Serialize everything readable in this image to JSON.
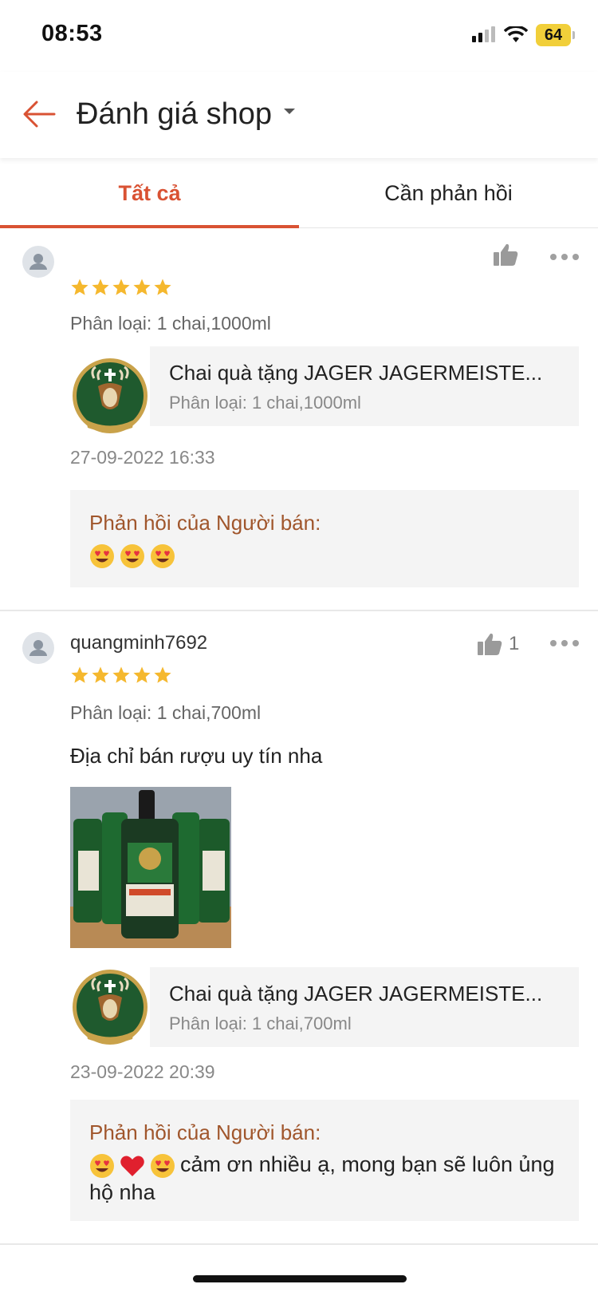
{
  "status_bar": {
    "time": "08:53",
    "battery": "64"
  },
  "header": {
    "title": "Đánh giá shop"
  },
  "tabs": [
    {
      "label": "Tất cả",
      "active": true
    },
    {
      "label": "Cần phản hồi",
      "active": false
    }
  ],
  "reviews": [
    {
      "username": "",
      "likes": "",
      "rating": 5,
      "variant": "Phân loại: 1 chai,1000ml",
      "comment": "",
      "product": {
        "name": "Chai quà tặng JAGER JAGERMEISTE...",
        "variant": "Phân loại: 1 chai,1000ml"
      },
      "timestamp": "27-09-2022 16:33",
      "reply_label": "Phản hồi của Người bán:",
      "reply_text": ""
    },
    {
      "username": "quangminh7692",
      "likes": "1",
      "rating": 5,
      "variant": "Phân loại: 1 chai,700ml",
      "comment": "Địa chỉ bán rượu uy tín nha",
      "product": {
        "name": "Chai quà tặng JAGER JAGERMEISTE...",
        "variant": "Phân loại: 1 chai,700ml"
      },
      "timestamp": "23-09-2022 20:39",
      "reply_label": "Phản hồi của Người bán:",
      "reply_text": "cảm ơn nhiều ạ, mong bạn sẽ luôn ủng hộ nha"
    }
  ],
  "colors": {
    "accent": "#d95233",
    "star": "#f5b82e",
    "reply_label": "#a0562c"
  },
  "icons": [
    "back-arrow-icon",
    "caret-down-icon",
    "wifi-icon",
    "signal-icon",
    "battery-icon",
    "thumbs-up-icon",
    "more-icon",
    "star-icon",
    "heart-eyes-emoji",
    "red-heart-emoji",
    "user-avatar-icon"
  ]
}
